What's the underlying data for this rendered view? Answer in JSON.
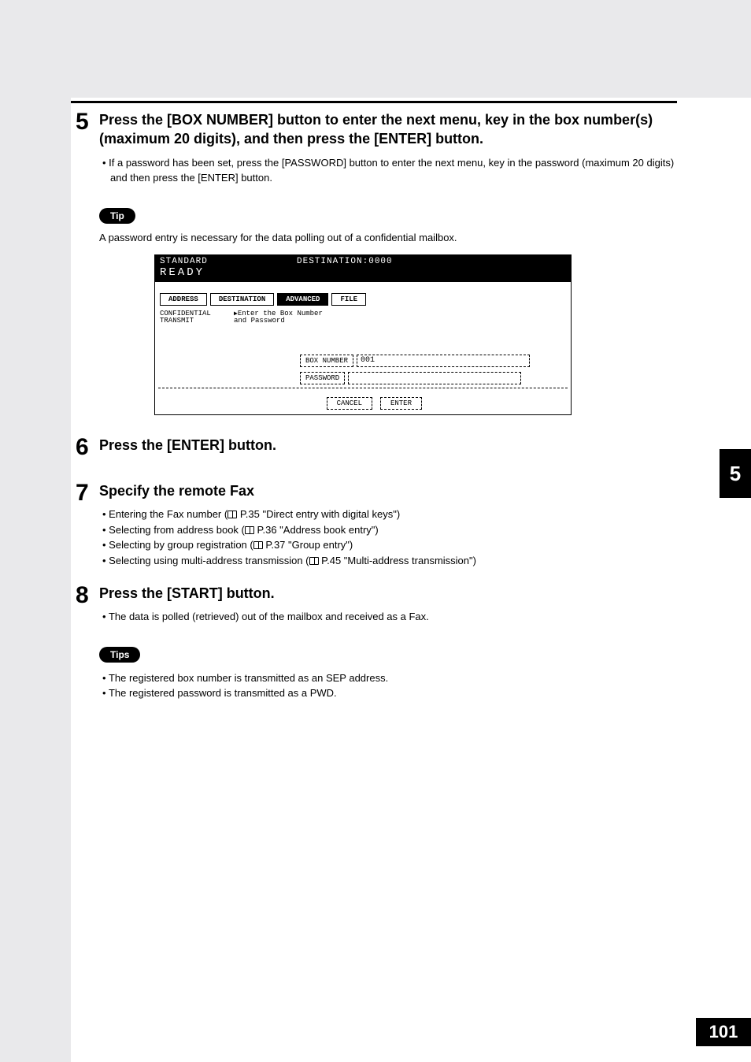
{
  "steps": {
    "s5": {
      "num": "5",
      "title": "Press the [BOX NUMBER] button to enter the next menu, key in the box number(s) (maximum 20 digits), and then press the [ENTER] button.",
      "bullet": "If a password has been set, press the [PASSWORD] button to enter the next menu, key in the password (maximum 20 digits) and then press the [ENTER] button."
    },
    "s6": {
      "num": "6",
      "title": "Press the [ENTER] button."
    },
    "s7": {
      "num": "7",
      "title": "Specify the remote Fax",
      "bullets": [
        {
          "pre": "Entering the Fax number (",
          "ref": " P.35 \"Direct entry with digital keys\")"
        },
        {
          "pre": "Selecting from address book (",
          "ref": " P.36 \"Address book entry\")"
        },
        {
          "pre": "Selecting by group registration (",
          "ref": " P.37 \"Group entry\")"
        },
        {
          "pre": "Selecting using multi-address transmission (",
          "ref": " P.45 \"Multi-address transmission\")"
        }
      ]
    },
    "s8": {
      "num": "8",
      "title": "Press the [START] button.",
      "bullet": "The data is polled (retrieved) out of the mailbox and received as a Fax."
    }
  },
  "tip": {
    "label": "Tip",
    "text": "A password entry is necessary for the data polling out of a confidential mailbox."
  },
  "tips2": {
    "label": "Tips",
    "bullets": [
      "The registered box number is transmitted as an SEP address.",
      "The registered password is transmitted as a PWD."
    ]
  },
  "lcd": {
    "standard": "STANDARD",
    "ready": "READY",
    "destination": "DESTINATION:0000",
    "tabs": {
      "address": "ADDRESS",
      "destination_tab": "DESTINATION",
      "advanced": "ADVANCED",
      "file": "FILE"
    },
    "sub1": "CONFIDENTIAL\nTRANSMIT",
    "sub2": "Enter the Box Number\nand Password",
    "box_number_btn": "BOX NUMBER",
    "box_number_val": "001",
    "password_btn": "PASSWORD",
    "cancel": "CANCEL",
    "enter": "ENTER"
  },
  "side_tab": "5",
  "page_number": "101"
}
